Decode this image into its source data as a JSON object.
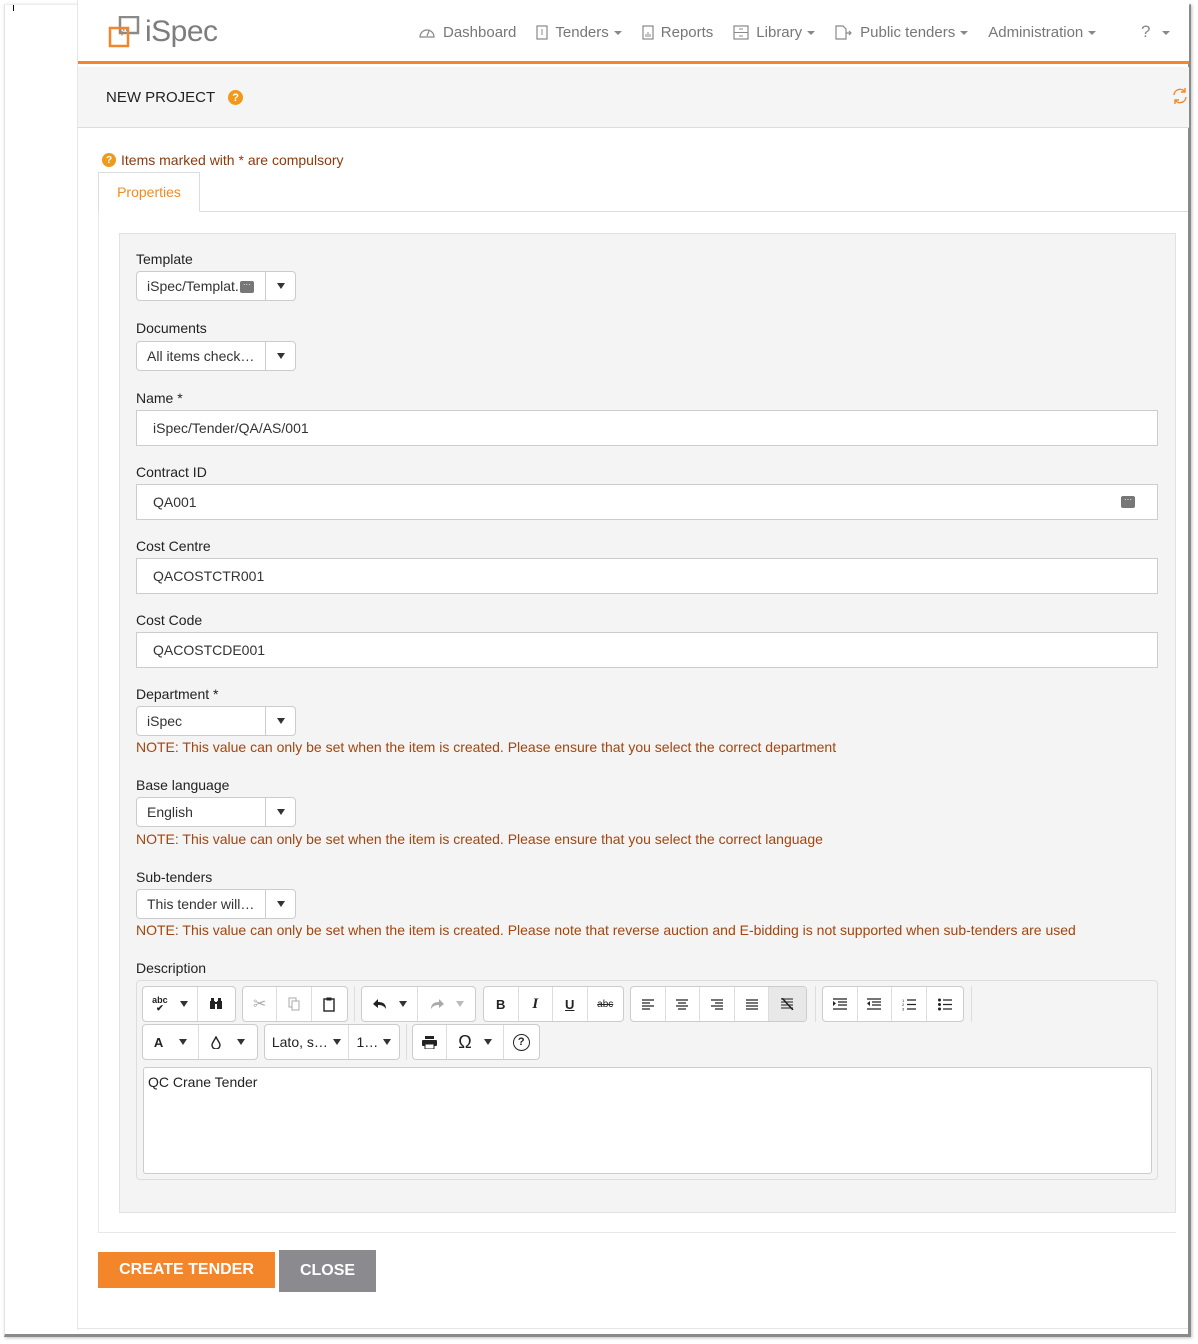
{
  "app": {
    "logo_text": "iSpec",
    "brand_color": "#f3862a"
  },
  "nav": {
    "items": [
      {
        "label": "Dashboard",
        "icon": "dashboard-gauge-icon",
        "dropdown": false
      },
      {
        "label": "Tenders",
        "icon": "tender-document-icon",
        "dropdown": true
      },
      {
        "label": "Reports",
        "icon": "report-chart-icon",
        "dropdown": false
      },
      {
        "label": "Library",
        "icon": "library-cabinet-icon",
        "dropdown": true
      },
      {
        "label": "Public tenders",
        "icon": "public-export-icon",
        "dropdown": true
      },
      {
        "label": "Administration",
        "icon": "",
        "dropdown": true
      }
    ],
    "help_icon": "?"
  },
  "page": {
    "title": "NEW PROJECT",
    "help_glyph": "?",
    "compulsory_note": "Items marked with * are compulsory"
  },
  "tabs": [
    {
      "label": "Properties",
      "active": true
    }
  ],
  "form": {
    "template": {
      "label": "Template",
      "value": "iSpec/Templat."
    },
    "documents": {
      "label": "Documents",
      "value": "All items check…"
    },
    "name": {
      "label": "Name *",
      "value": "iSpec/Tender/QA/AS/001"
    },
    "contract_id": {
      "label": "Contract ID",
      "value": "QA001"
    },
    "cost_centre": {
      "label": "Cost Centre",
      "value": "QACOSTCTR001"
    },
    "cost_code": {
      "label": "Cost Code",
      "value": "QACOSTCDE001"
    },
    "department": {
      "label": "Department *",
      "value": "iSpec",
      "note": "NOTE: This value can only be set when the item is created. Please ensure that you select the correct department"
    },
    "base_language": {
      "label": "Base language",
      "value": "English",
      "note": "NOTE: This value can only be set when the item is created. Please ensure that you select the correct language"
    },
    "sub_tenders": {
      "label": "Sub-tenders",
      "value": "This tender will…",
      "note": "NOTE: This value can only be set when the item is created. Please note that reverse auction and E-bidding is not supported when sub-tenders are used"
    },
    "description": {
      "label": "Description",
      "value": "QC Crane Tender",
      "font_family_select": "Lato, s…",
      "font_size_select": "1…",
      "toolbar": {
        "bold": "B",
        "italic": "I",
        "underline": "U",
        "strike": "abc",
        "text_color": "A",
        "spell": "abc",
        "special_char": "Ω"
      }
    }
  },
  "buttons": {
    "create": "CREATE TENDER",
    "close": "CLOSE"
  }
}
